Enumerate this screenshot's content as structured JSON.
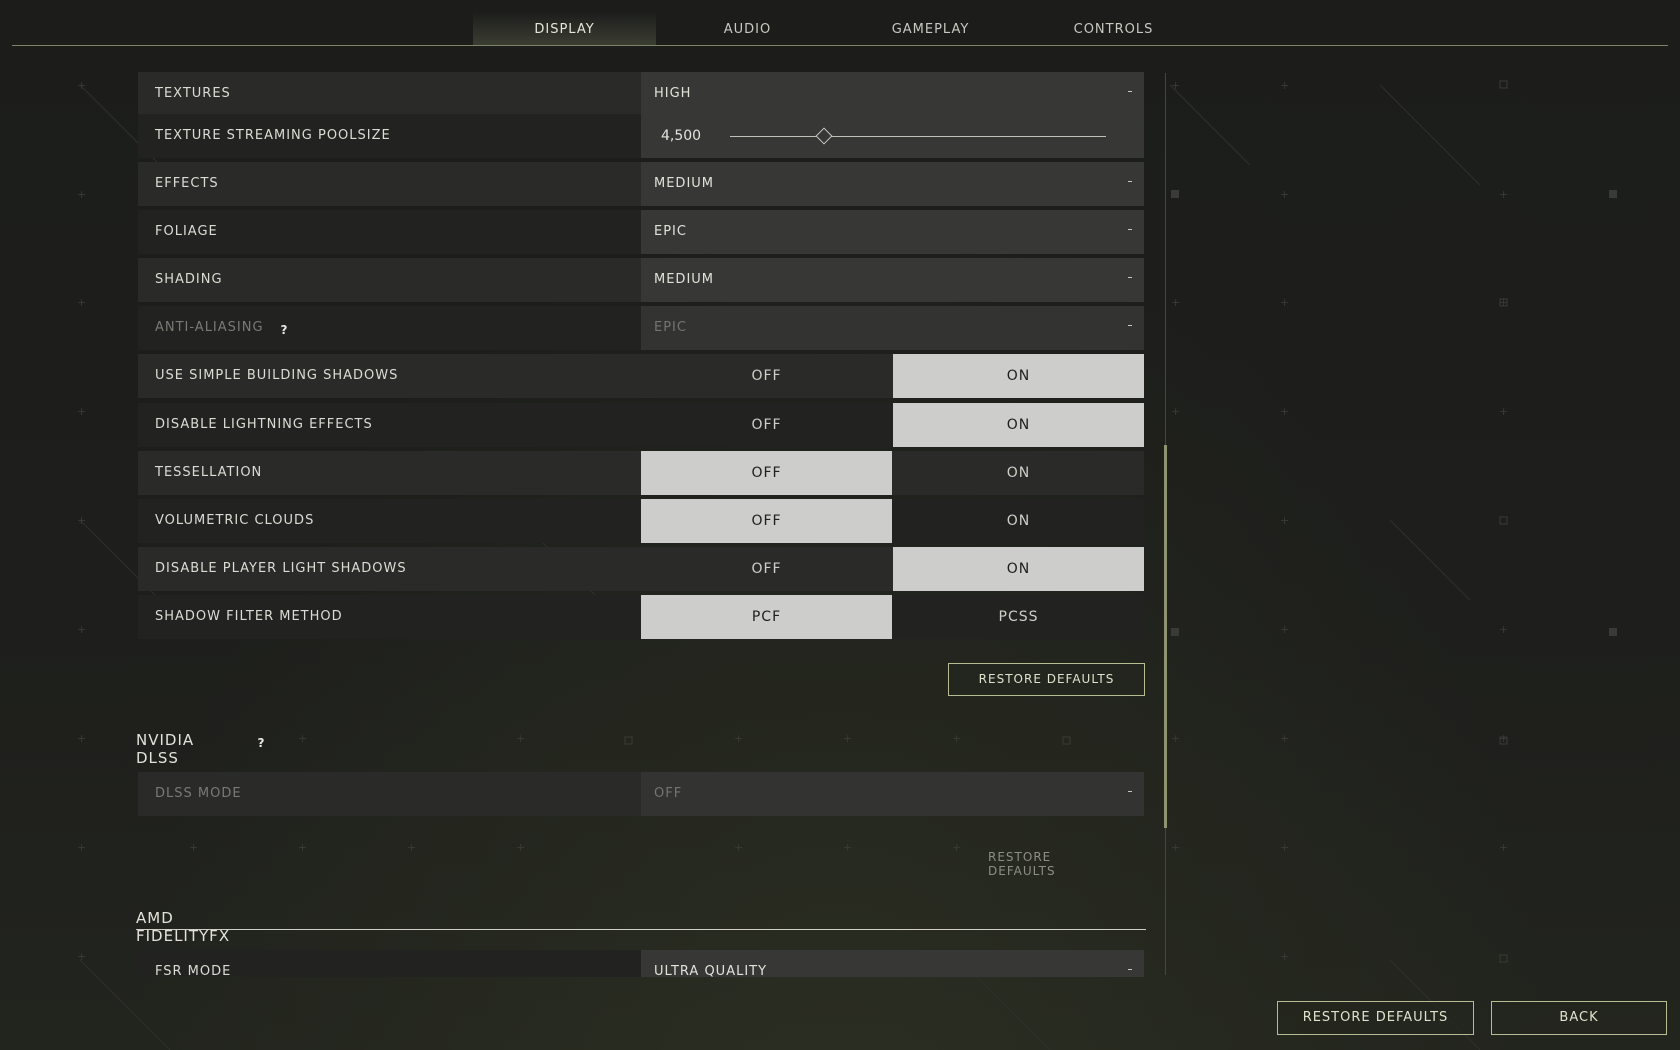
{
  "tabs": [
    {
      "label": "DISPLAY",
      "active": true
    },
    {
      "label": "AUDIO",
      "active": false
    },
    {
      "label": "GAMEPLAY",
      "active": false
    },
    {
      "label": "CONTROLS",
      "active": false
    }
  ],
  "settings": {
    "textures": {
      "label": "TEXTURES",
      "value": "HIGH"
    },
    "texture_streaming": {
      "label": "TEXTURE STREAMING POOLSIZE",
      "value": "4,500",
      "slider_fraction": 0.25
    },
    "effects": {
      "label": "EFFECTS",
      "value": "MEDIUM"
    },
    "foliage": {
      "label": "FOLIAGE",
      "value": "EPIC"
    },
    "shading": {
      "label": "SHADING",
      "value": "MEDIUM"
    },
    "anti_aliasing": {
      "label": "ANTI-ALIASING",
      "value": "EPIC",
      "help": "?"
    },
    "simple_building_shadows": {
      "label": "USE SIMPLE BUILDING SHADOWS",
      "off": "OFF",
      "on": "ON",
      "selected": "on"
    },
    "disable_lightning": {
      "label": "DISABLE LIGHTNING EFFECTS",
      "off": "OFF",
      "on": "ON",
      "selected": "on"
    },
    "tessellation": {
      "label": "TESSELLATION",
      "off": "OFF",
      "on": "ON",
      "selected": "off"
    },
    "volumetric_clouds": {
      "label": "VOLUMETRIC CLOUDS",
      "off": "OFF",
      "on": "ON",
      "selected": "off"
    },
    "disable_player_light_shadows": {
      "label": "DISABLE PLAYER LIGHT SHADOWS",
      "off": "OFF",
      "on": "ON",
      "selected": "on"
    },
    "shadow_filter": {
      "label": "SHADOW FILTER METHOD",
      "opt_a": "PCF",
      "opt_b": "PCSS",
      "selected": "a"
    },
    "restore_defaults_label": "RESTORE DEFAULTS"
  },
  "dlss": {
    "title": "NVIDIA DLSS",
    "help": "?",
    "mode": {
      "label": "DLSS MODE",
      "value": "OFF"
    },
    "restore_defaults_label": "RESTORE DEFAULTS"
  },
  "fidelityfx": {
    "title": "AMD FIDELITYFX",
    "fsr_mode": {
      "label": "FSR MODE",
      "value": "ULTRA QUALITY"
    }
  },
  "footer": {
    "restore_defaults_label": "RESTORE DEFAULTS",
    "back_label": "BACK"
  },
  "colors": {
    "accent": "#b7bc93",
    "selected_toggle": "#cdcdcb",
    "background": "#1d1e1b"
  }
}
